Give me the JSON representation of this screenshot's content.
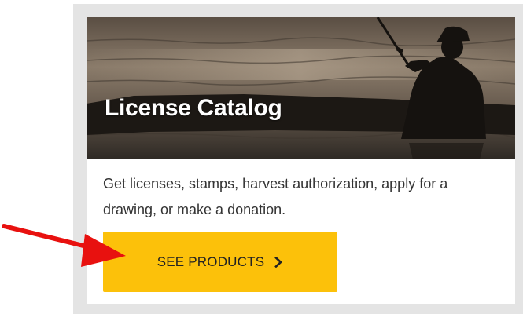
{
  "card": {
    "title": "License Catalog",
    "description": "Get licenses, stamps, harvest authorization, apply for a drawing, or make a donation.",
    "button_label": "SEE PRODUCTS",
    "button_icon": "chevron-right-icon",
    "hero_image": "fisherman-silhouette-in-kayak"
  },
  "annotation": {
    "icon": "red-arrow",
    "color": "#e8110f"
  },
  "colors": {
    "button": "#fcc10a",
    "frame": "#e4e4e4"
  }
}
